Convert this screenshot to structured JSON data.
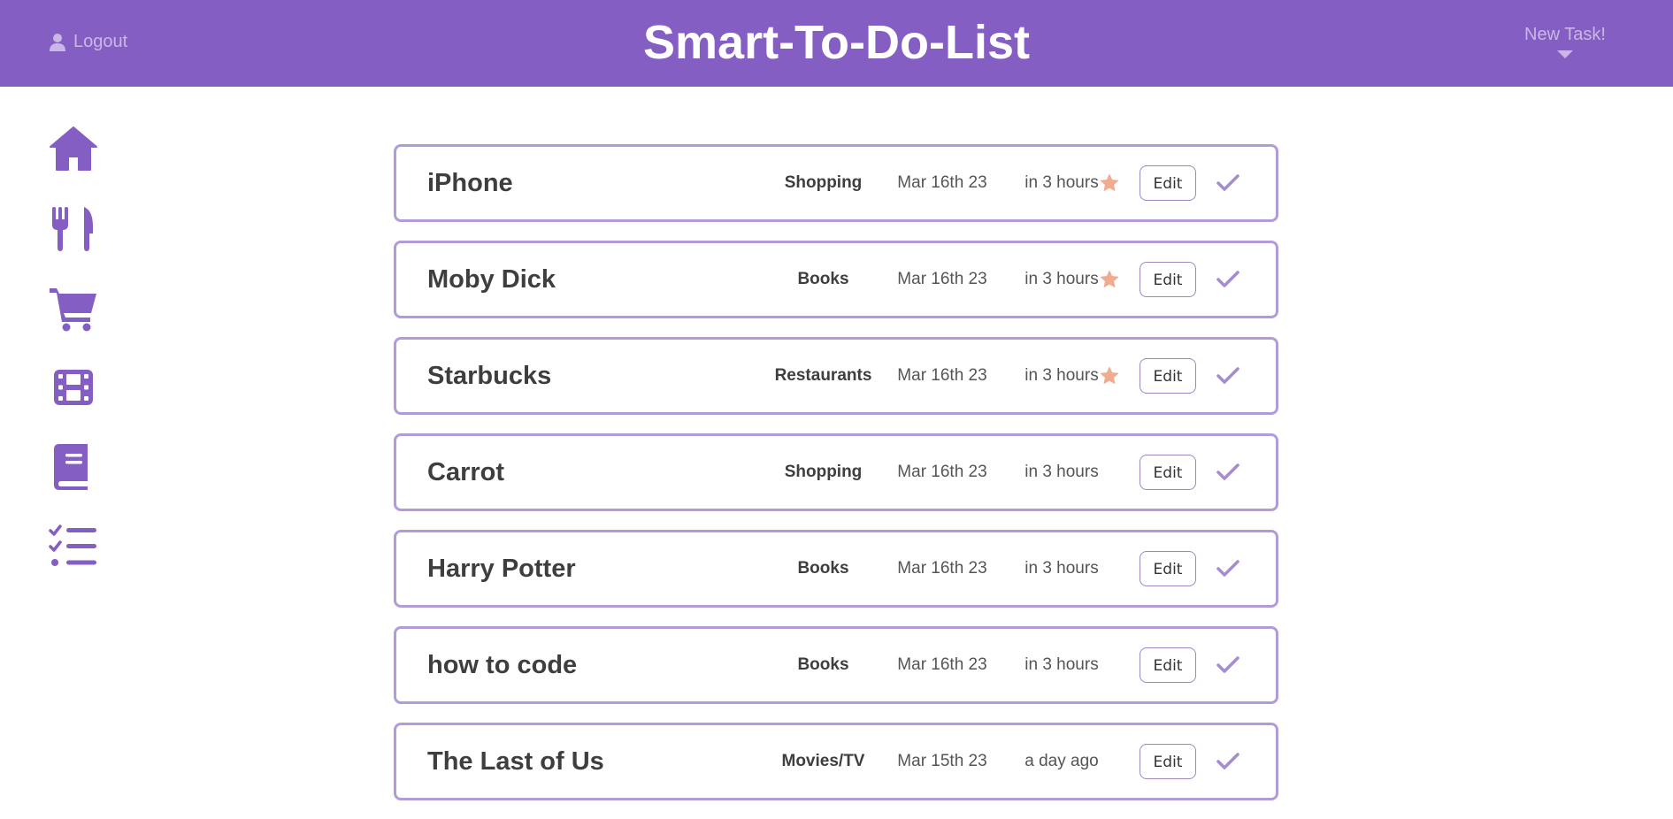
{
  "header": {
    "logout_label": "Logout",
    "title": "Smart-To-Do-List",
    "new_task_label": "New Task!",
    "background_color": "#845ec2"
  },
  "sidebar": {
    "items": [
      {
        "icon": "home-icon"
      },
      {
        "icon": "utensils-icon"
      },
      {
        "icon": "shopping-cart-icon"
      },
      {
        "icon": "film-icon"
      },
      {
        "icon": "book-icon"
      },
      {
        "icon": "list-check-icon"
      }
    ]
  },
  "tasks": [
    {
      "name": "iPhone",
      "category": "Shopping",
      "date": "Mar 16th 23",
      "relative": "in 3 hours",
      "starred": true,
      "edit_label": "Edit"
    },
    {
      "name": "Moby Dick",
      "category": "Books",
      "date": "Mar 16th 23",
      "relative": "in 3 hours",
      "starred": true,
      "edit_label": "Edit"
    },
    {
      "name": "Starbucks",
      "category": "Restaurants",
      "date": "Mar 16th 23",
      "relative": "in 3 hours",
      "starred": true,
      "edit_label": "Edit"
    },
    {
      "name": "Carrot",
      "category": "Shopping",
      "date": "Mar 16th 23",
      "relative": "in 3 hours",
      "starred": false,
      "edit_label": "Edit"
    },
    {
      "name": "Harry Potter",
      "category": "Books",
      "date": "Mar 16th 23",
      "relative": "in 3 hours",
      "starred": false,
      "edit_label": "Edit"
    },
    {
      "name": "how to code",
      "category": "Books",
      "date": "Mar 16th 23",
      "relative": "in 3 hours",
      "starred": false,
      "edit_label": "Edit"
    },
    {
      "name": "The Last of Us",
      "category": "Movies/TV",
      "date": "Mar 15th 23",
      "relative": "a day ago",
      "starred": false,
      "edit_label": "Edit"
    }
  ],
  "colors": {
    "accent": "#845ec2",
    "row_border": "#b19cd9",
    "star": "#f0ab91",
    "check": "#a48ccf"
  }
}
